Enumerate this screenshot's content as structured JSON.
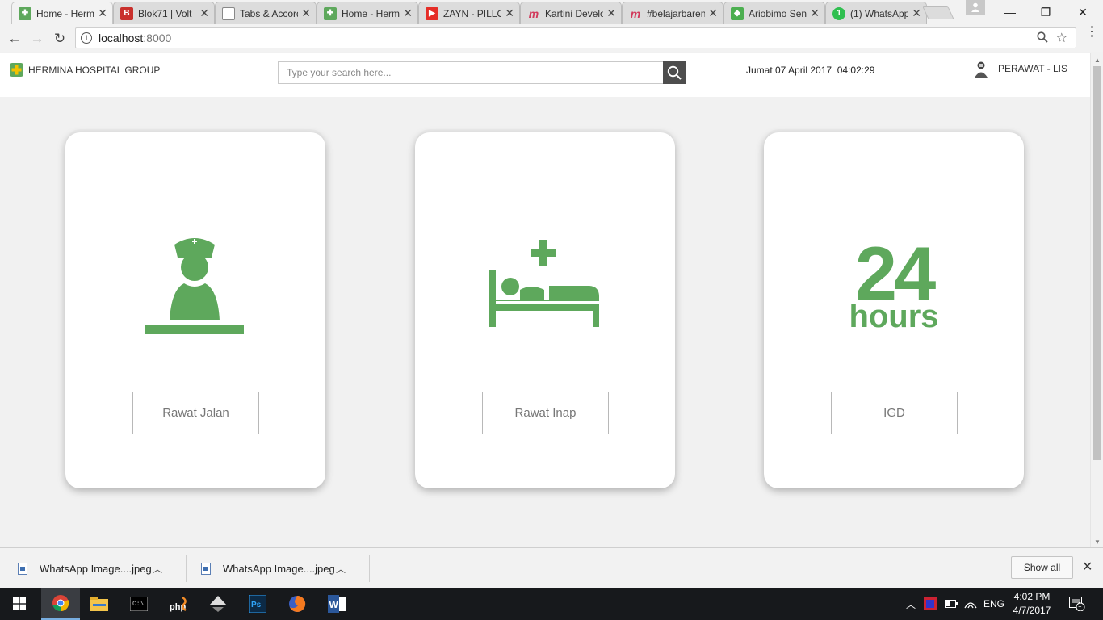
{
  "browser": {
    "tabs": [
      {
        "title": "Home - Hermina",
        "favicon": "hermina-logo-icon",
        "color": "#5ea85c",
        "active": true
      },
      {
        "title": "Blok71 | Volt",
        "favicon": "blok71-icon",
        "color": "#c9302c",
        "active": false
      },
      {
        "title": "Tabs & Accordion",
        "favicon": "document-icon",
        "color": "#888888",
        "active": false
      },
      {
        "title": "Home - Hermina",
        "favicon": "hermina-logo-icon",
        "color": "#5ea85c",
        "active": false
      },
      {
        "title": "ZAYN - PILLOWTALK",
        "favicon": "youtube-icon",
        "color": "#e52d27",
        "active": false
      },
      {
        "title": "Kartini Developer",
        "favicon": "medium-m-icon",
        "color": "#d23a5c",
        "active": false
      },
      {
        "title": "#belajarbareng",
        "favicon": "medium-m-icon",
        "color": "#d23a5c",
        "active": false
      },
      {
        "title": "Ariobimo Sentral",
        "favicon": "google-maps-icon",
        "color": "#4caf50",
        "active": false
      },
      {
        "title": "(1) WhatsApp",
        "favicon": "whatsapp-icon",
        "color": "#2fbf4f",
        "active": false
      }
    ],
    "url_host": "localhost",
    "url_port": ":8000",
    "window_controls": {
      "minimize": "—",
      "maximize": "❐",
      "close": "✕"
    }
  },
  "app": {
    "brand": "HERMINA HOSPITAL GROUP",
    "search_placeholder": "Type your search here...",
    "datetime": "Jumat 07 April 2017  04:02:29",
    "user": "PERAWAT - LIS",
    "accent_color": "#5ea85c"
  },
  "cards": [
    {
      "label": "Rawat Jalan",
      "icon": "nurse-icon"
    },
    {
      "label": "Rawat Inap",
      "icon": "hospital-bed-icon"
    },
    {
      "label": "IGD",
      "icon": "24-hours-icon",
      "icon_text_top": "24",
      "icon_text_bottom": "hours"
    }
  ],
  "downloads": {
    "items": [
      {
        "name": "WhatsApp Image....jpeg"
      },
      {
        "name": "WhatsApp Image....jpeg"
      }
    ],
    "show_all": "Show all"
  },
  "taskbar": {
    "apps": [
      "windows-start-icon",
      "chrome-icon",
      "file-explorer-icon",
      "terminal-icon",
      "php-icon",
      "inkscape-icon",
      "photoshop-icon",
      "firefox-icon",
      "word-icon"
    ],
    "language": "ENG",
    "time": "4:02 PM",
    "date": "4/7/2017",
    "notification_count": "1"
  }
}
